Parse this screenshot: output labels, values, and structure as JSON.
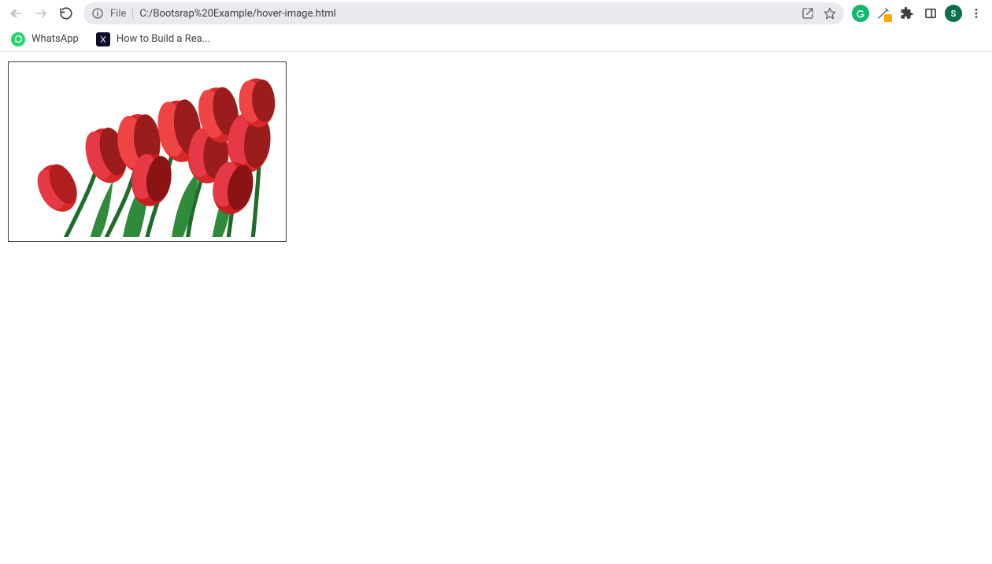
{
  "toolbar": {
    "scheme_label": "File",
    "url": "C:/Bootsrap%20Example/hover-image.html",
    "profile_initial": "S"
  },
  "bookmarks": [
    {
      "label": "WhatsApp",
      "icon": "whatsapp"
    },
    {
      "label": "How to Build a Rea...",
      "icon": "react"
    }
  ],
  "content": {
    "image_alt": "Red tulips bouquet"
  },
  "colors": {
    "omnibox_bg": "#e8eaed",
    "toolbar_icon": "#5f6368",
    "accent_green": "#11b76b",
    "profile_bg": "#0b6e4f",
    "whatsapp": "#25d366",
    "border": "#e0e0e0",
    "frame_border": "#3c3c3c",
    "tulip_red": "#d62828",
    "tulip_red_dark": "#9b1c1c",
    "leaf_green": "#2f8a3a",
    "leaf_green_dark": "#1f6b2a"
  }
}
